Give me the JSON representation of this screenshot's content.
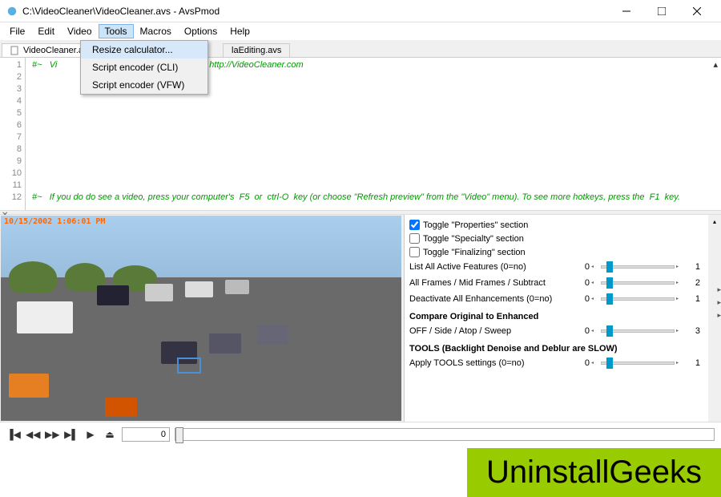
{
  "titlebar": {
    "title": "C:\\VideoCleaner\\VideoCleaner.avs - AvsPmod"
  },
  "menubar": {
    "items": [
      "File",
      "Edit",
      "Video",
      "Tools",
      "Macros",
      "Options",
      "Help"
    ],
    "active": "Tools"
  },
  "dropdown": {
    "items": [
      "Resize calculator...",
      "Script encoder (CLI)",
      "Script encoder (VFW)"
    ]
  },
  "tabs": {
    "front": "VideoCleaner.avs",
    "back_suffix": "laEditing.avs"
  },
  "editor": {
    "lines": [
      1,
      2,
      3,
      4,
      5,
      6,
      7,
      8,
      9,
      10,
      11,
      12
    ],
    "line1_prefix": "#~   Vi",
    "line1_url": "http://VideoCleaner.com",
    "line12": "#~   If you do do see a video, press your computer's  F5  or  ctrl-O  key (or choose \"Refresh preview\" from the \"Video\" menu). To see more hotkeys, press the  F1  key."
  },
  "preview": {
    "timestamp": "10/15/2002 1:06:01 PM"
  },
  "properties": {
    "checks": [
      {
        "label": "Toggle \"Properties\" section",
        "checked": true
      },
      {
        "label": "Toggle \"Specialty\" section",
        "checked": false
      },
      {
        "label": "Toggle \"Finalizing\" section",
        "checked": false
      }
    ],
    "sliders": [
      {
        "label": "List All Active Features (0=no)",
        "left": "0",
        "right": "1",
        "value": "0"
      },
      {
        "label": "All Frames / Mid Frames / Subtract",
        "left": "0",
        "right": "2",
        "value": "0"
      },
      {
        "label": "Deactivate All Enhancements (0=no)",
        "left": "0",
        "right": "1",
        "value": "0"
      }
    ],
    "header_compare": "Compare Original to Enhanced",
    "compare_slider": {
      "label": "OFF / Side / Atop / Sweep",
      "left": "0",
      "right": "3",
      "value": "0"
    },
    "header_tools": "TOOLS (Backlight Denoise and Deblur are SLOW)",
    "tools_slider": {
      "label": "Apply TOOLS settings (0=no)",
      "left": "0",
      "right": "1",
      "value": "0"
    }
  },
  "playbar": {
    "frame": "0"
  },
  "watermark": "UninstallGeeks"
}
